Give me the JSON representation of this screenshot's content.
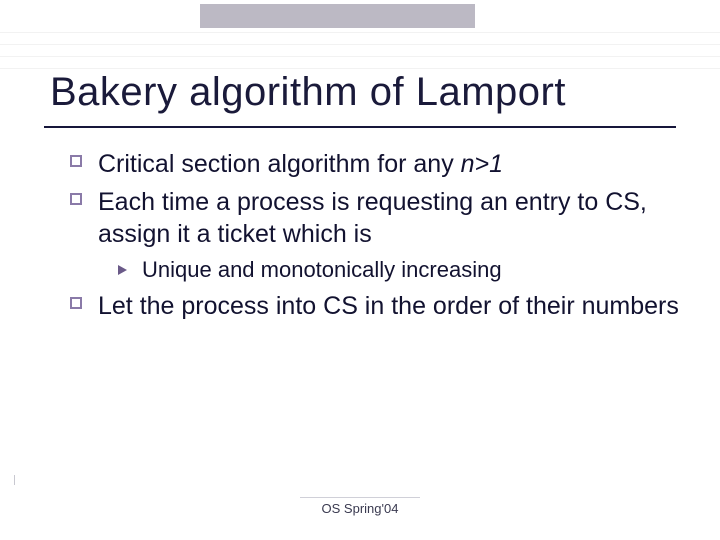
{
  "title": "Bakery algorithm of Lamport",
  "bullets": {
    "b1_pre": "Critical section algorithm for any ",
    "b1_em": "n>1",
    "b2": "Each time a process is requesting an entry to CS, assign it a ticket which is",
    "b2_sub": "Unique and monotonically increasing",
    "b3": "Let the process into CS in the order of their numbers"
  },
  "footer": "OS Spring'04"
}
